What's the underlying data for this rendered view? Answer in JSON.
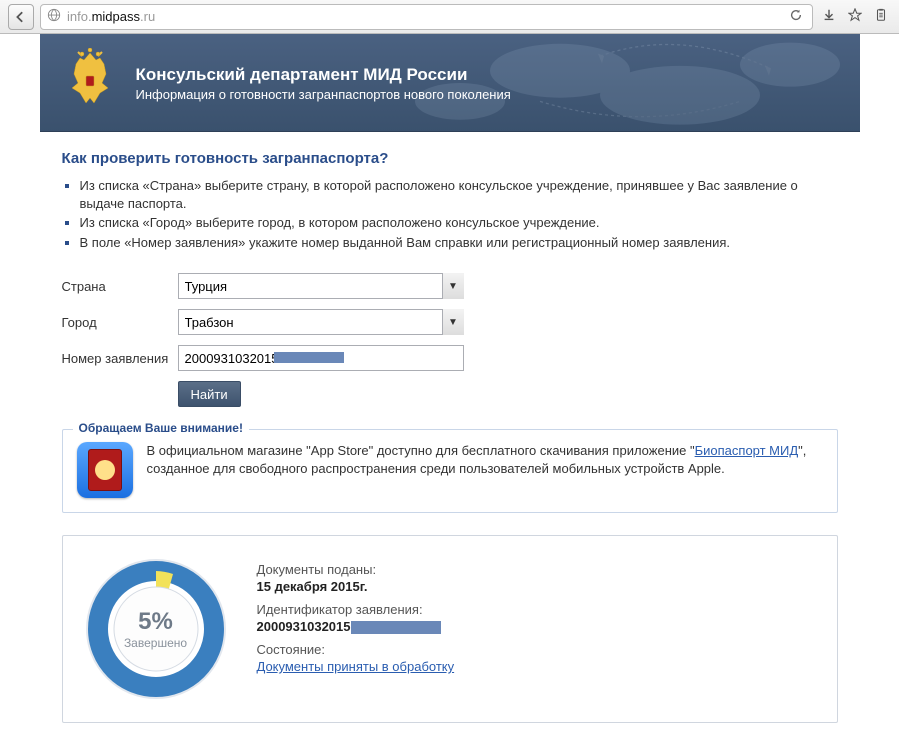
{
  "browser": {
    "url_prefix": "info.",
    "url_host": "midpass",
    "url_suffix": ".ru"
  },
  "header": {
    "title": "Консульский департамент МИД России",
    "subtitle": "Информация о готовности загранпаспортов нового поколения"
  },
  "section": {
    "title": "Как проверить готовность загранпаспорта?",
    "instructions": [
      "Из списка «Страна» выберите страну, в которой расположено консульское учреждение, принявшее у Вас заявление о выдаче паспорта.",
      "Из списка «Город» выберите город, в котором расположено консульское учреждение.",
      "В поле «Номер заявления» укажите номер выданной Вам справки или регистрационный номер заявления."
    ]
  },
  "form": {
    "country_label": "Страна",
    "country_value": "Турция",
    "city_label": "Город",
    "city_value": "Трабзон",
    "appnum_label": "Номер заявления",
    "appnum_value": "2000931032015",
    "submit_label": "Найти"
  },
  "notice": {
    "legend": "Обращаем Ваше внимание!",
    "text_before": "В официальном магазине \"App Store\" доступно для бесплатного скачивания приложение \"",
    "link_text": "Биопаспорт МИД",
    "text_after": "\", созданное для свободного распространения среди пользователей мобильных устройств Apple."
  },
  "result": {
    "percent": "5%",
    "percent_label": "Завершено",
    "docs_label": "Документы поданы:",
    "docs_value": "15 декабря 2015г.",
    "id_label": "Идентификатор заявления:",
    "id_value": "2000931032015",
    "status_label": "Состояние:",
    "status_value": "Документы приняты в обработку"
  }
}
